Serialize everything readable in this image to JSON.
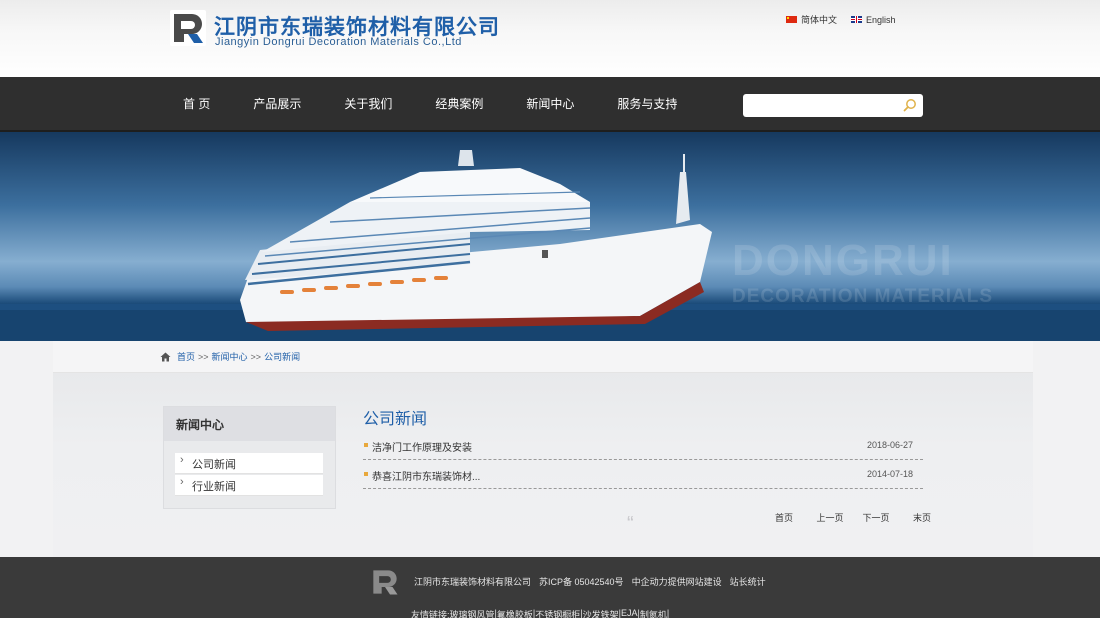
{
  "header": {
    "company_cn": "江阴市东瑞装饰材料有限公司",
    "company_en": "Jiangyin Dongrui Decoration Materials Co.,Ltd",
    "languages": [
      {
        "label": "简体中文",
        "flag": "china-flag-icon"
      },
      {
        "label": "English",
        "flag": "uk-flag-icon"
      }
    ]
  },
  "nav": {
    "items": [
      {
        "label": "首 页"
      },
      {
        "label": "产品展示"
      },
      {
        "label": "关于我们"
      },
      {
        "label": "经典案例"
      },
      {
        "label": "新闻中心"
      },
      {
        "label": "服务与支持"
      }
    ],
    "search": {
      "placeholder": "",
      "value": "",
      "icon": "search-icon"
    }
  },
  "banner": {
    "watermark_line1": "DONGRUI",
    "watermark_line2": "DECORATION MATERIALS"
  },
  "breadcrumb": {
    "items": [
      "首页",
      "新闻中心",
      "公司新闻"
    ],
    "separator": ">>"
  },
  "sidebar": {
    "title": "新闻中心",
    "items": [
      {
        "label": "公司新闻"
      },
      {
        "label": "行业新闻"
      }
    ]
  },
  "main": {
    "title": "公司新闻",
    "news": [
      {
        "title": "洁净门工作原理及安装",
        "date": "2018-06-27"
      },
      {
        "title": "恭喜江阴市东瑞装饰材...",
        "date": "2014-07-18"
      }
    ],
    "pager": {
      "first": "首页",
      "prev": "上一页",
      "next": "下一页",
      "last": "末页"
    }
  },
  "footer": {
    "company": "江阴市东瑞装饰材料有限公司",
    "icp": "苏ICP备 05042540号",
    "builder": "中企动力提供网站建设",
    "stats": "站长统计",
    "links_label": "友情链接:",
    "links": [
      "玻璃钢风管",
      "氟橡胶板",
      "不锈钢橱柜",
      "沙发铁架",
      "EJA",
      "制氮机"
    ]
  },
  "colors": {
    "brand_blue": "#1f5fa8",
    "nav_bg": "#2f2f2f",
    "footer_bg": "#3a3a3a",
    "bullet": "#e8a83c"
  }
}
